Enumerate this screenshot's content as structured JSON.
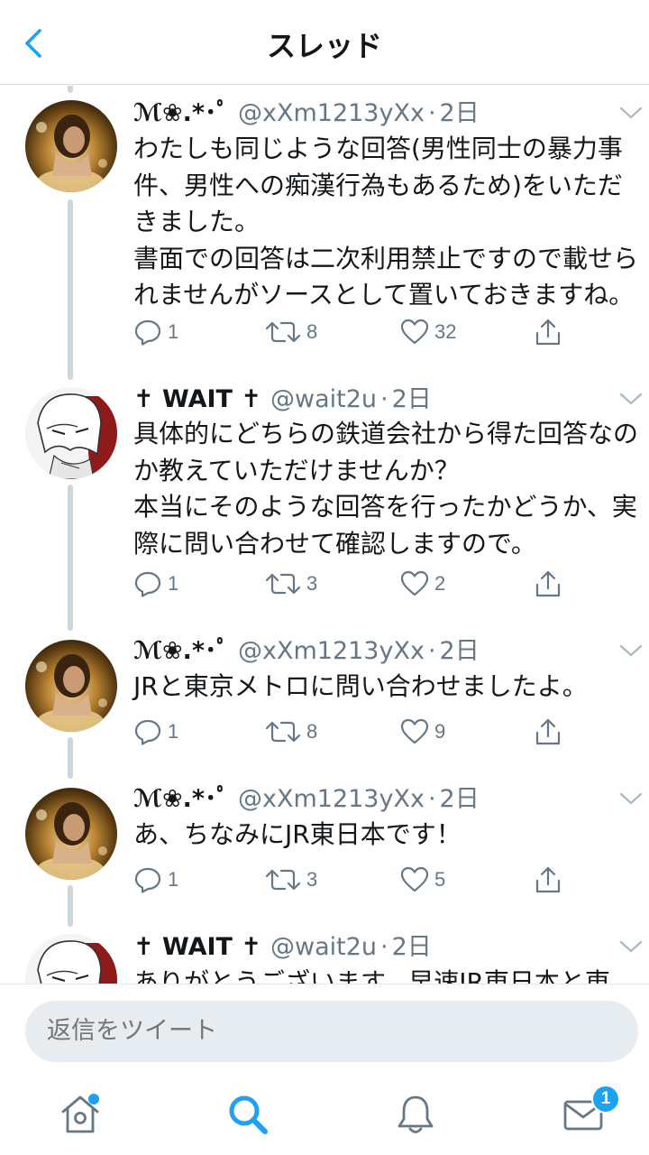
{
  "header": {
    "title": "スレッド"
  },
  "colors": {
    "accent": "#1da1f2",
    "text": "#14171a",
    "secondary": "#657786",
    "thread_line": "#ccd6dd"
  },
  "tweets": [
    {
      "name": "ℳ❀.*･ﾟ",
      "handle": "@xXm1213yXx",
      "time": "2日",
      "body": "わたしも同じような回答(男性同士の暴力事件、男性への痴漢行為もあるため)をいただきました。\n書面での回答は二次利用禁止ですので載せられませんがソースとして置いておきますね。",
      "replies": "1",
      "retweets": "8",
      "likes": "32"
    },
    {
      "name": "✝ WAIT ✝",
      "handle": "@wait2u",
      "time": "2日",
      "body": "具体的にどちらの鉄道会社から得た回答なのか教えていただけませんか？\n本当にそのような回答を行ったかどうか、実際に問い合わせて確認しますので。",
      "replies": "1",
      "retweets": "3",
      "likes": "2"
    },
    {
      "name": "ℳ❀.*･ﾟ",
      "handle": "@xXm1213yXx",
      "time": "2日",
      "body": "JRと東京メトロに問い合わせましたよ。",
      "replies": "1",
      "retweets": "8",
      "likes": "9"
    },
    {
      "name": "ℳ❀.*･ﾟ",
      "handle": "@xXm1213yXx",
      "time": "2日",
      "body": "あ、ちなみにJR東日本です！",
      "replies": "1",
      "retweets": "3",
      "likes": "5"
    },
    {
      "name": "✝ WAIT ✝",
      "handle": "@wait2u",
      "time": "2日",
      "body": "ありがとうございます。早速JR東日本と東"
    }
  ],
  "reply_bar": {
    "placeholder": "返信をツイート"
  },
  "tabbar": {
    "messages_badge": "1"
  },
  "icons": {
    "back": "chevron-left-icon",
    "caret": "chevron-down-icon",
    "reply": "reply-icon",
    "retweet": "retweet-icon",
    "like": "heart-icon",
    "share": "share-icon",
    "home": "home-icon",
    "search": "search-icon",
    "notifications": "bell-icon",
    "messages": "envelope-icon"
  }
}
